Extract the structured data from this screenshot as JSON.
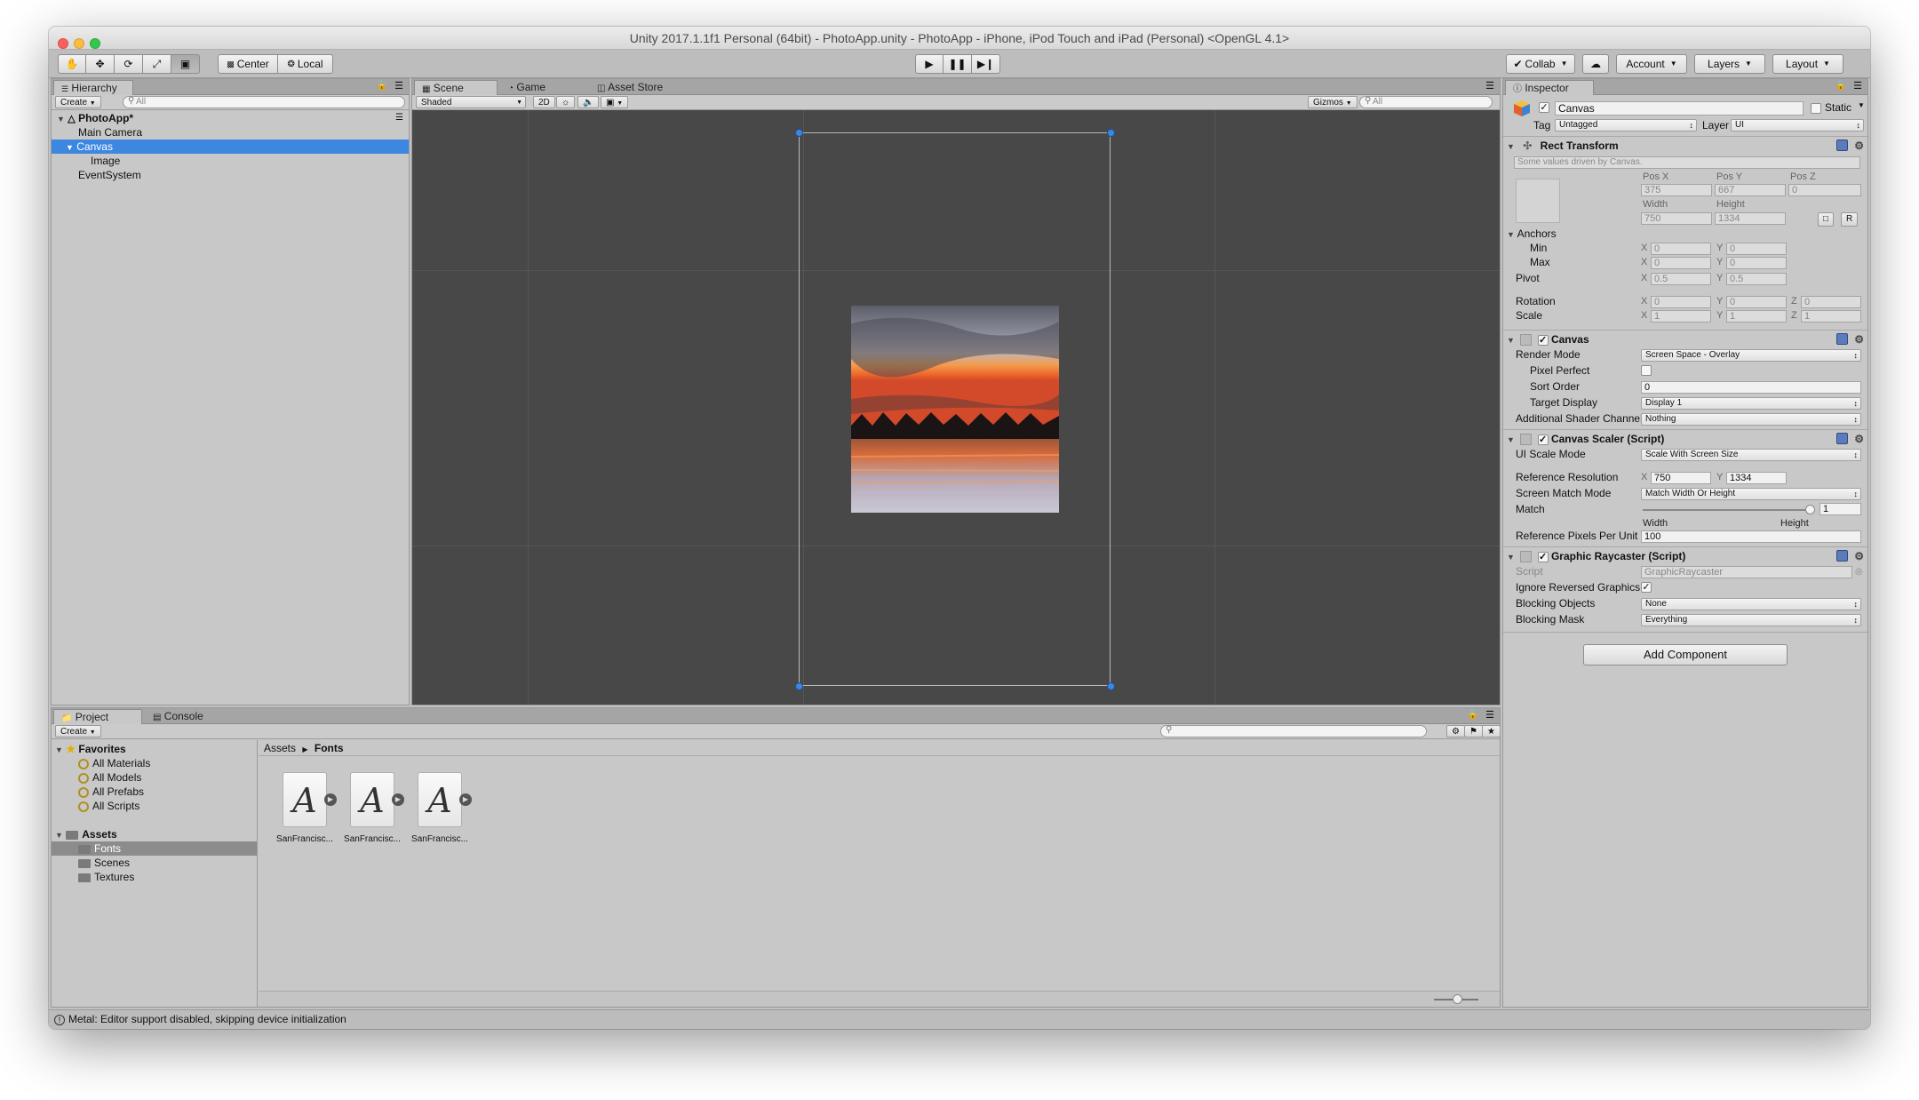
{
  "window": {
    "title": "Unity 2017.1.1f1 Personal (64bit) - PhotoApp.unity - PhotoApp - iPhone, iPod Touch and iPad (Personal) <OpenGL 4.1>"
  },
  "colors": {
    "accent_selection": "#3d87e0",
    "scene_bg": "#484848",
    "traffic_close": "#fc605c",
    "traffic_min": "#fdbc40",
    "traffic_max": "#34c84a"
  },
  "toolbar": {
    "tools": [
      "hand-icon",
      "move-icon",
      "rotate-icon",
      "scale-icon",
      "rect-icon"
    ],
    "pivot_center": "Center",
    "pivot_local": "Local",
    "collab": "Collab",
    "account": "Account",
    "layers": "Layers",
    "layout": "Layout"
  },
  "hierarchy": {
    "tab": "Hierarchy",
    "create": "Create",
    "search_placeholder": "All",
    "scene_name": "PhotoApp*",
    "items": [
      {
        "label": "Main Camera"
      },
      {
        "label": "Canvas"
      },
      {
        "label": "Image"
      },
      {
        "label": "EventSystem"
      }
    ]
  },
  "scene_view": {
    "tabs": [
      "Scene",
      "Game",
      "Asset Store"
    ],
    "shading": "Shaded",
    "mode_2d": "2D",
    "gizmos": "Gizmos",
    "search_placeholder": "All"
  },
  "project": {
    "tabs": [
      "Project",
      "Console"
    ],
    "create": "Create",
    "favorites_label": "Favorites",
    "favorites": [
      "All Materials",
      "All Models",
      "All Prefabs",
      "All Scripts"
    ],
    "assets_label": "Assets",
    "folders": [
      "Fonts",
      "Scenes",
      "Textures"
    ],
    "breadcrumb": [
      "Assets",
      "Fonts"
    ],
    "files": [
      "SanFrancisc...",
      "SanFrancisc...",
      "SanFrancisc..."
    ]
  },
  "status": {
    "message": "Metal: Editor support disabled, skipping device initialization"
  },
  "inspector": {
    "tab": "Inspector",
    "object_name": "Canvas",
    "static_label": "Static",
    "tag_label": "Tag",
    "tag_value": "Untagged",
    "layer_label": "Layer",
    "layer_value": "UI",
    "rect_transform": {
      "title": "Rect Transform",
      "note": "Some values driven by Canvas.",
      "posx_label": "Pos X",
      "posy_label": "Pos Y",
      "posz_label": "Pos Z",
      "posx": "375",
      "posy": "667",
      "posz": "0",
      "width_label": "Width",
      "height_label": "Height",
      "width": "750",
      "height": "1334",
      "r_button": "R",
      "anchors_label": "Anchors",
      "min_label": "Min",
      "max_label": "Max",
      "min_x": "0",
      "min_y": "0",
      "max_x": "0",
      "max_y": "0",
      "pivot_label": "Pivot",
      "pivot_x": "0.5",
      "pivot_y": "0.5",
      "rotation_label": "Rotation",
      "rot_x": "0",
      "rot_y": "0",
      "rot_z": "0",
      "scale_label": "Scale",
      "scale_x": "1",
      "scale_y": "1",
      "scale_z": "1",
      "x": "X",
      "y": "Y",
      "z": "Z"
    },
    "canvas": {
      "title": "Canvas",
      "render_mode_label": "Render Mode",
      "render_mode": "Screen Space - Overlay",
      "pixel_perfect_label": "Pixel Perfect",
      "sort_order_label": "Sort Order",
      "sort_order": "0",
      "target_display_label": "Target Display",
      "target_display": "Display 1",
      "shader_channel_label": "Additional Shader Channel",
      "shader_channel": "Nothing"
    },
    "canvas_scaler": {
      "title": "Canvas Scaler (Script)",
      "scale_mode_label": "UI Scale Mode",
      "scale_mode": "Scale With Screen Size",
      "ref_res_label": "Reference Resolution",
      "ref_x": "750",
      "ref_y": "1334",
      "match_mode_label": "Screen Match Mode",
      "match_mode": "Match Width Or Height",
      "match_label": "Match",
      "match_value": "1",
      "match_width": "Width",
      "match_height": "Height",
      "ppu_label": "Reference Pixels Per Unit",
      "ppu": "100"
    },
    "raycaster": {
      "title": "Graphic Raycaster (Script)",
      "script_label": "Script",
      "script_value": "GraphicRaycaster",
      "ignore_reversed_label": "Ignore Reversed Graphics",
      "blocking_objects_label": "Blocking Objects",
      "blocking_objects": "None",
      "blocking_mask_label": "Blocking Mask",
      "blocking_mask": "Everything"
    },
    "add_component": "Add Component"
  }
}
